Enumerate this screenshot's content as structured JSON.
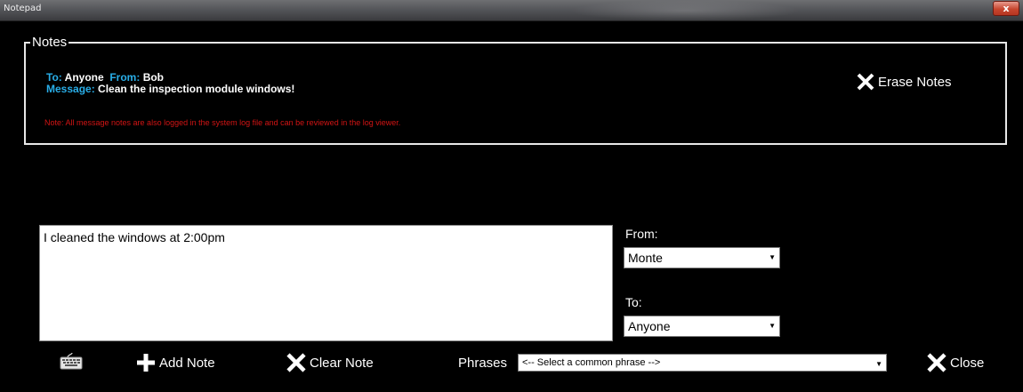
{
  "window": {
    "title": "Notepad",
    "close_glyph": "x"
  },
  "notes": {
    "legend": "Notes",
    "to_label": "To:",
    "to_value": "Anyone",
    "from_label": "From:",
    "from_value": "Bob",
    "message_label": "Message:",
    "message_value": "Clean the inspection module windows!",
    "disclaimer": "Note: All message notes are also logged in the system log file and can be reviewed in the log viewer.",
    "erase_label": "Erase Notes"
  },
  "editor": {
    "text": "I cleaned the windows at 2:00pm",
    "from_label": "From:",
    "from_value": "Monte",
    "to_label": "To:",
    "to_value": "Anyone"
  },
  "toolbar": {
    "keyboard_icon": "keyboard-icon",
    "add_label": "Add Note",
    "clear_label": "Clear Note",
    "phrases_label": "Phrases",
    "phrase_value": "<--   Select a common phrase   -->",
    "close_label": "Close"
  },
  "colors": {
    "background": "#000000",
    "label_blue": "#29aee8",
    "disclaimer_red": "#d21414",
    "close_red": "#c7462f"
  }
}
